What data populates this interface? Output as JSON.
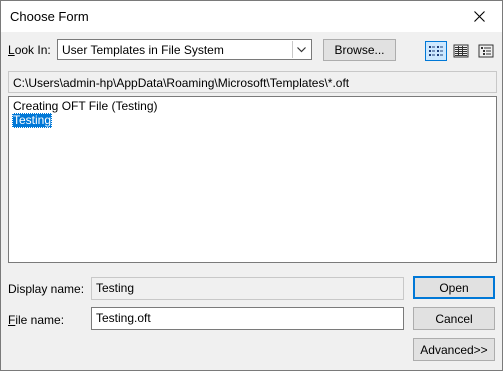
{
  "window": {
    "title": "Choose Form"
  },
  "look_in": {
    "label_prefix": "L",
    "label_rest": "ook In:",
    "value": "User Templates in File System"
  },
  "buttons": {
    "browse": "Browse...",
    "open": "Open",
    "cancel": "Cancel",
    "advanced": "Advanced>>"
  },
  "path": "C:\\Users\\admin-hp\\AppData\\Roaming\\Microsoft\\Templates\\*.oft",
  "list": {
    "items": [
      {
        "label": "Creating OFT File (Testing)",
        "selected": false
      },
      {
        "label": "Testing",
        "selected": true
      }
    ]
  },
  "display_name": {
    "label_prefix": "Display name:",
    "value": "Testing"
  },
  "file_name": {
    "label_prefix": "F",
    "label_rest": "ile name:",
    "value": "Testing.oft"
  },
  "icons": {
    "close": "close-icon",
    "dropdown": "chevron-down-icon",
    "view_list": "list-view-icon",
    "view_details": "details-view-icon",
    "view_properties": "properties-view-icon"
  },
  "colors": {
    "accent": "#0078d7",
    "selection": "#0078d7",
    "window_bg": "#f0f0f0"
  }
}
